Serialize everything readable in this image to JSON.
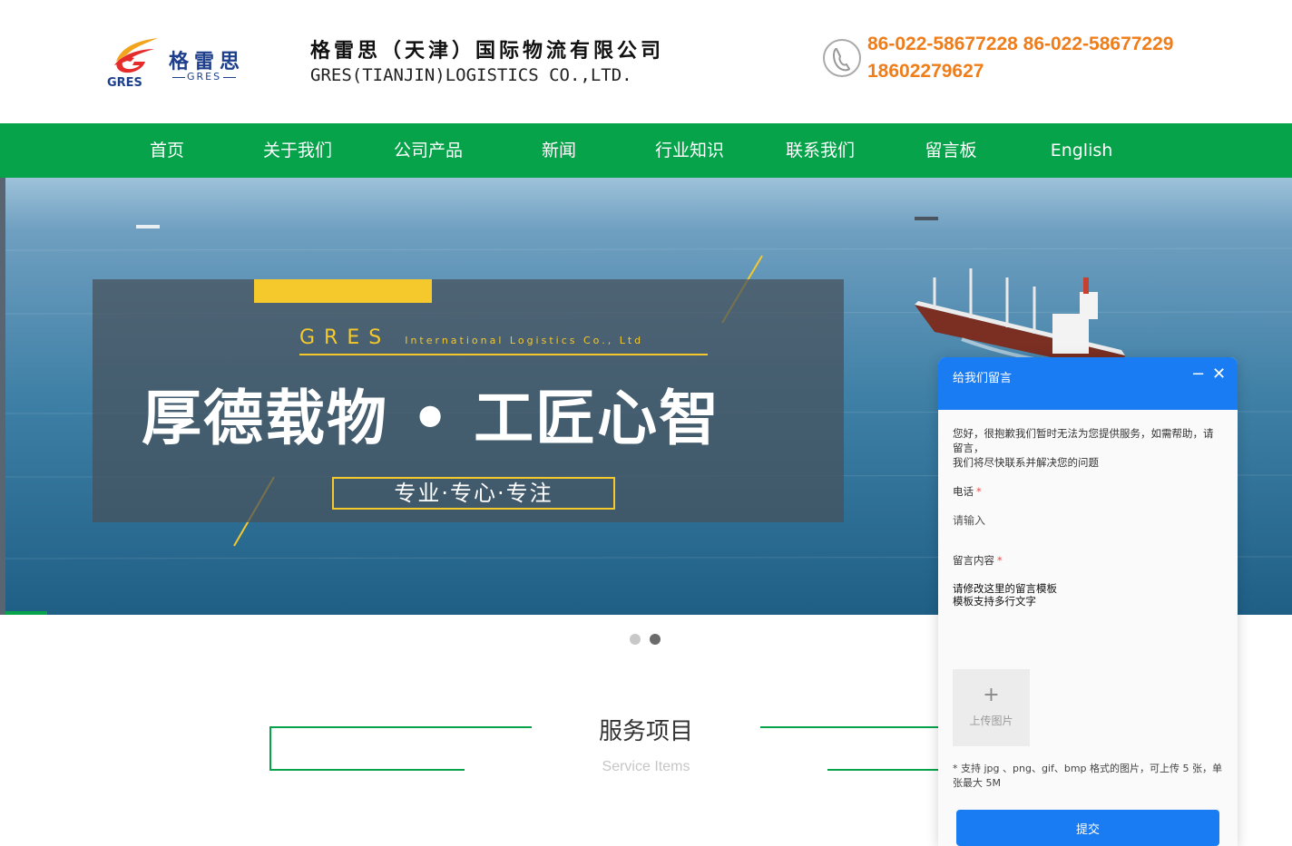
{
  "header": {
    "logo_cn": "格雷思",
    "logo_en": "GRES",
    "logo_mark_text": "GRES",
    "company_cn": "格雷思（天津）国际物流有限公司",
    "company_en": "GRES(TIANJIN)LOGISTICS CO.,LTD.",
    "phone_line1": "86-022-58677228 86-022-58677229",
    "phone_line2": "18602279627"
  },
  "nav": {
    "items": [
      {
        "label": "首页"
      },
      {
        "label": "关于我们"
      },
      {
        "label": "公司产品"
      },
      {
        "label": "新闻"
      },
      {
        "label": "行业知识"
      },
      {
        "label": "联系我们"
      },
      {
        "label": "留言板"
      },
      {
        "label": "English"
      }
    ]
  },
  "banner": {
    "brand": "GRES",
    "brand_small": "International Logistics Co., Ltd",
    "slogan": "厚德载物 • 工匠心智",
    "subslogan": "专业·专心·专注",
    "slides": 2,
    "active_slide": 2
  },
  "services": {
    "title": "服务项目",
    "subtitle": "Service Items"
  },
  "chat": {
    "title": "给我们留言",
    "minimize": "−",
    "close": "✕",
    "intro_line1": "您好，很抱歉我们暂时无法为您提供服务，如需帮助，请留言，",
    "intro_line2": "我们将尽快联系并解决您的问题",
    "phone_label": "电话",
    "phone_placeholder": "请输入",
    "message_label": "留言内容",
    "message_value": "请修改这里的留言模板\n模板支持多行文字",
    "required_mark": "*",
    "upload_plus": "+",
    "upload_label": "上传图片",
    "upload_note": "* 支持 jpg 、png、gif、bmp 格式的图片，可上传 5 张，单张最大 5M",
    "submit_label": "提交"
  },
  "colors": {
    "nav_green": "#06a34a",
    "phone_orange": "#ef7d1a",
    "chat_blue": "#1a7cf2",
    "banner_yellow": "#f5c92b",
    "logo_blue": "#1e3f8c"
  }
}
